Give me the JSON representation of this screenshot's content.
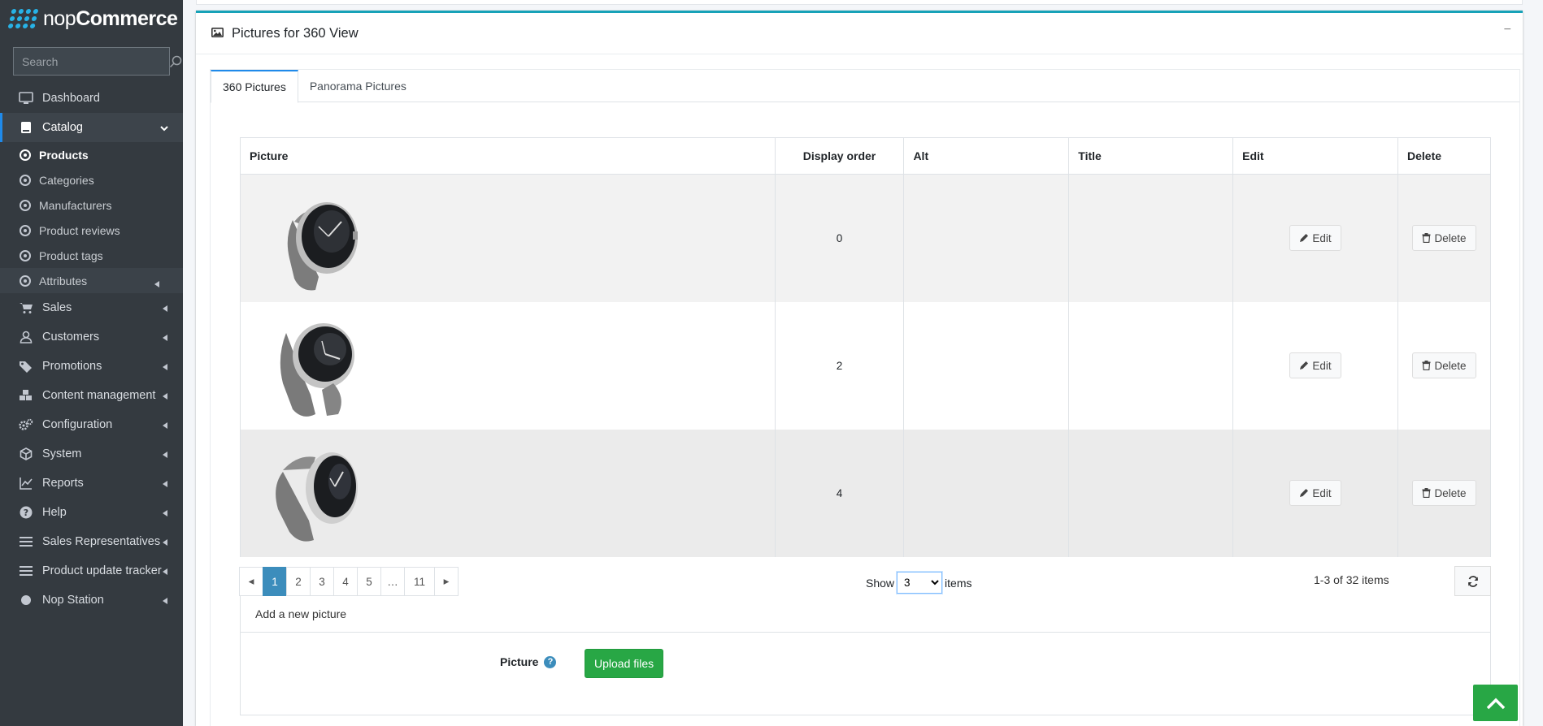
{
  "brand": {
    "light": "nop",
    "bold": "Commerce"
  },
  "search": {
    "placeholder": "Search"
  },
  "nav": {
    "dashboard": "Dashboard",
    "catalog": "Catalog",
    "catalog_children": {
      "products": "Products",
      "categories": "Categories",
      "manufacturers": "Manufacturers",
      "product_reviews": "Product reviews",
      "product_tags": "Product tags",
      "attributes": "Attributes"
    },
    "sales": "Sales",
    "customers": "Customers",
    "promotions": "Promotions",
    "content_management": "Content management",
    "configuration": "Configuration",
    "system": "System",
    "reports": "Reports",
    "help": "Help",
    "sales_representatives": "Sales Representatives",
    "product_update_tracker": "Product update tracker",
    "nop_station": "Nop Station"
  },
  "card": {
    "title": "Pictures for 360 View",
    "collapse": "−"
  },
  "tabs": {
    "pictures_360": "360 Pictures",
    "panorama": "Panorama Pictures"
  },
  "table": {
    "headers": {
      "picture": "Picture",
      "display_order": "Display order",
      "alt": "Alt",
      "title": "Title",
      "edit": "Edit",
      "delete": "Delete"
    },
    "rows": [
      {
        "display_order": "0",
        "alt": "",
        "title": "",
        "edit_label": "Edit",
        "delete_label": "Delete"
      },
      {
        "display_order": "2",
        "alt": "",
        "title": "",
        "edit_label": "Edit",
        "delete_label": "Delete"
      },
      {
        "display_order": "4",
        "alt": "",
        "title": "",
        "edit_label": "Edit",
        "delete_label": "Delete"
      }
    ]
  },
  "pager": {
    "prev": "◂",
    "pages": [
      "1",
      "2",
      "3",
      "4",
      "5",
      "…",
      "11"
    ],
    "next": "▸",
    "current_page": "1",
    "show_label": "Show",
    "page_size": "3",
    "items_label": "items",
    "summary": "1-3 of 32 items"
  },
  "add_picture": {
    "heading": "Add a new picture",
    "label": "Picture",
    "help": "?",
    "upload_button": "Upload files"
  },
  "colors": {
    "accent": "#3c8dbc",
    "success": "#28a745",
    "card_border": "#17a2b8",
    "sidebar": "#343a40"
  }
}
